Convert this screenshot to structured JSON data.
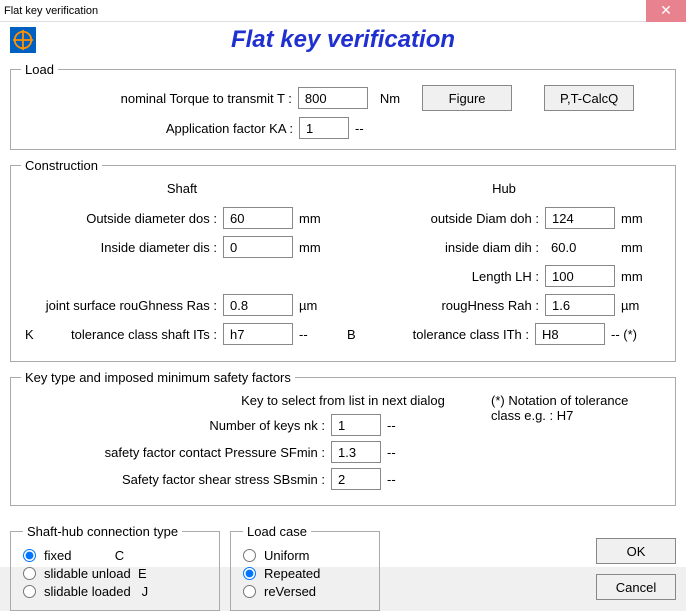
{
  "window": {
    "title": "Flat key verification"
  },
  "header": {
    "title": "Flat key verification"
  },
  "load": {
    "legend": "Load",
    "torque_label": "nominal Torque to transmit   T   :",
    "torque_value": "800",
    "torque_unit": "Nm",
    "figure_btn": "Figure",
    "ptcalc_btn": "P,T-CalcQ",
    "appfactor_label": "Application factor   KA :",
    "appfactor_value": "1",
    "appfactor_unit": "--"
  },
  "construction": {
    "legend": "Construction",
    "shaft_header": "Shaft",
    "hub_header": "Hub",
    "shaft": {
      "od_label": "Outside diameter  dos :",
      "od_value": "60",
      "od_unit": "mm",
      "id_label": "Inside diameter  dis  :",
      "id_value": "0",
      "id_unit": "mm",
      "rough_label": "joint surface rouGhness Ras :",
      "rough_value": "0.8",
      "rough_unit": "µm",
      "tol_prefix": "K",
      "tol_label": "tolerance class shaft   ITs :",
      "tol_value": "h7",
      "tol_unit": "--"
    },
    "hub": {
      "od_label": "outside Diam  doh :",
      "od_value": "124",
      "od_unit": "mm",
      "id_label": "inside diam  dih :",
      "id_value": "60.0",
      "id_unit": "mm",
      "len_label": "Length   LH :",
      "len_value": "100",
      "len_unit": "mm",
      "rough_label": "rougHness  Rah :",
      "rough_value": "1.6",
      "rough_unit": "µm",
      "tol_prefix": "B",
      "tol_label": "tolerance class    ITh :",
      "tol_value": "H8",
      "tol_unit": "-- (*)"
    }
  },
  "keytype": {
    "legend": "Key type and imposed minimum safety factors",
    "instruction": "Key to select from list in next dialog",
    "notation": "(*) Notation of tolerance class e.g. : H7",
    "nk_label": "Number of keys   nk :",
    "nk_value": "1",
    "nk_unit": "--",
    "sfmin_label": "safety factor contact Pressure  SFmin :",
    "sfmin_value": "1.3",
    "sfmin_unit": "--",
    "sbsmin_label": "Safety factor shear stress  SBsmin :",
    "sbsmin_value": "2",
    "sbsmin_unit": "--"
  },
  "conntype": {
    "legend": "Shaft-hub connection type",
    "opt1": "fixed            C",
    "opt2": "slidable unload  E",
    "opt3": "slidable loaded   J",
    "selected": "fixed"
  },
  "loadcase": {
    "legend": "Load case",
    "opt1": "Uniform",
    "opt2": "Repeated",
    "opt3": "reVersed",
    "selected": "Repeated"
  },
  "buttons": {
    "ok": "OK",
    "cancel": "Cancel"
  }
}
